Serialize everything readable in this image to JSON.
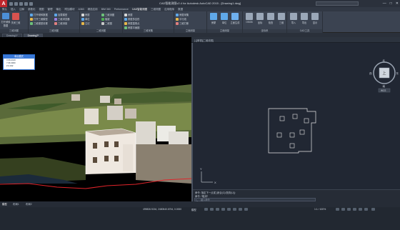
{
  "window": {
    "title": "CAD智能测图v2.4 for Autodesk AutoCAD 2015 - [Drawing1.dwg]",
    "window_controls": [
      "—",
      "□",
      "✕"
    ]
  },
  "ribbon_tabs": [
    "默认",
    "插入",
    "注释",
    "参数化",
    "视图",
    "管理",
    "输出",
    "附加模块",
    "A360",
    "精选应用",
    "BIM 360",
    "Performance",
    "CAD智能测图",
    "三维测图",
    "应用程序",
    "数据"
  ],
  "ribbon": {
    "groups": [
      {
        "label": "三维测图",
        "items": [
          "打开倾斜数据",
          "打开三维模型",
          "三维模型设置",
          "加载模型",
          "三维浏览器",
          "三维测量"
        ]
      },
      {
        "label": "三维测图",
        "items": [
          "房屋",
          "单位",
          "注记",
          "三维测图",
          "植被",
          "二维图"
        ]
      },
      {
        "label": "二维测图",
        "items": [
          "房屋",
          "房屋多边形",
          "房屋直角点",
          "房屋平面图"
        ]
      },
      {
        "label": "三维采集",
        "items": [
          "房屋采集",
          "平行线",
          "三维打断"
        ]
      },
      {
        "label": "立面测量",
        "items": [
          "立面生成",
          "立面测量"
        ]
      },
      {
        "label": "坐标系",
        "items": [
          "OSGB",
          "三维",
          "坐标",
          "检查"
        ]
      },
      {
        "label": "CAD工具",
        "items": [
          "坐标",
          "导入",
          "导出",
          "显示"
        ]
      }
    ],
    "big_buttons": [
      "打开倾斜数据",
      "关闭三维",
      "CAD绘图",
      "插件",
      "房屋",
      "单位",
      "OSGB",
      "坐标",
      "检查"
    ]
  },
  "doc_tabs": [
    {
      "label": "Drawing1*",
      "active": false
    },
    {
      "label": "Drawing2*",
      "active": true
    }
  ],
  "left_view": {
    "label": "视口-三维",
    "info_panel": {
      "header": "单点模式",
      "lines": [
        "X:39.4120",
        "Y:36.3000",
        "Z:4.432"
      ]
    }
  },
  "right_view": {
    "header": "[-][俯视][二维线框]",
    "compass": {
      "center": "上",
      "n": "北",
      "s": "南",
      "e": "东",
      "w": "西",
      "wcs": "WCS"
    },
    "axis_labels": {
      "x": "X",
      "y": "Y"
    }
  },
  "command": {
    "history": [
      "命令: 指定下一点或 [闭合(C)/放弃(U)]:",
      "命令: *取消*"
    ],
    "prompt_placeholder": "键入命令"
  },
  "layout_tabs": [
    "模型",
    "布局1",
    "布局2"
  ],
  "status": {
    "coordinates": "499826.9216, 2480540.6754, 0.0000",
    "mode": "模型",
    "scale": "1:1 / 100%"
  },
  "colors": {
    "app_accent": "#c0272d",
    "info_header": "#3a78d6",
    "ground_line": "#e0242a"
  }
}
